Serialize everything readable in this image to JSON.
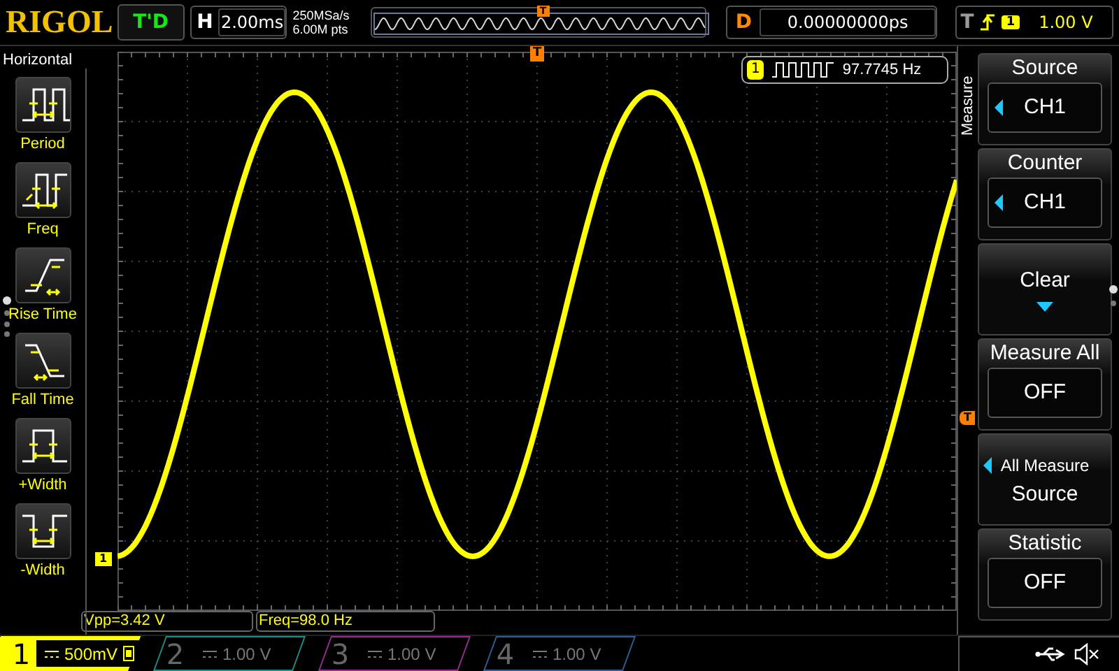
{
  "header": {
    "brand": "RIGOL",
    "run_state": "T'D",
    "timebase": {
      "label": "H",
      "value": "2.00ms"
    },
    "sample_rate": "250MSa/s",
    "memory_depth": "6.00M pts",
    "delay": {
      "label": "D",
      "value": "0.00000000ps"
    },
    "trigger": {
      "label": "T",
      "channel": "1",
      "level": "1.00 V"
    }
  },
  "left_menu": {
    "title": "Horizontal",
    "items": [
      {
        "label": "Period",
        "kind": "period"
      },
      {
        "label": "Freq",
        "kind": "freq"
      },
      {
        "label": "Rise Time",
        "kind": "rise"
      },
      {
        "label": "Fall Time",
        "kind": "fall"
      },
      {
        "label": "+Width",
        "kind": "pwidth"
      },
      {
        "label": "-Width",
        "kind": "nwidth"
      }
    ]
  },
  "overview_trigger_marker": "T",
  "screen": {
    "counter": {
      "channel": "1",
      "value": "97.7745 Hz"
    },
    "trigger_position_marker": "T",
    "trigger_level_marker": "T",
    "channel_marker": "1",
    "measurements": [
      "Vpp=3.42 V",
      "Freq=98.0 Hz"
    ]
  },
  "right_menu": {
    "title": "Measure",
    "items": [
      {
        "kind": "value",
        "label": "Source",
        "value": "CH1",
        "arrow": true
      },
      {
        "kind": "value",
        "label": "Counter",
        "value": "CH1",
        "arrow": true
      },
      {
        "kind": "action",
        "label": "Clear"
      },
      {
        "kind": "value",
        "label": "Measure All",
        "value": "OFF",
        "arrow": false
      },
      {
        "kind": "multi",
        "label": "All Measure",
        "sublabel": "Source",
        "arrow": true
      },
      {
        "kind": "value",
        "label": "Statistic",
        "value": "OFF",
        "arrow": false
      }
    ]
  },
  "channels": [
    {
      "name": "1",
      "scale": "500mV",
      "on": true,
      "color": "#ffff00"
    },
    {
      "name": "2",
      "scale": "1.00 V",
      "on": false,
      "color": "#1f8c86"
    },
    {
      "name": "3",
      "scale": "1.00 V",
      "on": false,
      "color": "#9a2c92"
    },
    {
      "name": "4",
      "scale": "1.00 V",
      "on": false,
      "color": "#2c5f99"
    }
  ]
}
